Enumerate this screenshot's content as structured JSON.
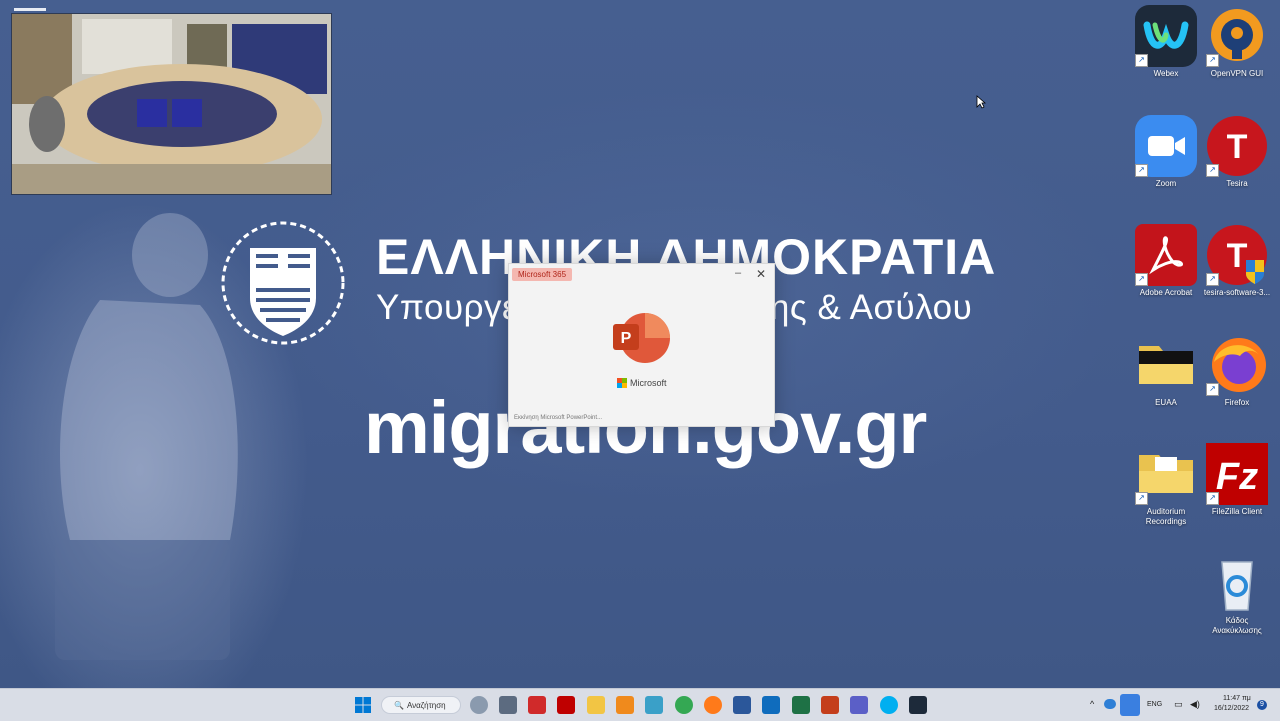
{
  "brand": {
    "title": "ΕΛΛΗΝΙΚΗ ΔΗΜΟΚΡΑΤΙΑ",
    "subtitle": "Υπουργείο Μετανάστευσης & Ασύλου",
    "url": "migration.gov.gr"
  },
  "splash": {
    "badge": "Microsoft 365",
    "company": "Microsoft",
    "status": "Εκκίνηση Microsoft PowerPoint..."
  },
  "desktop_icons": [
    {
      "name": "Webex",
      "icon": "webex-icon"
    },
    {
      "name": "OpenVPN GUI",
      "icon": "openvpn-icon"
    },
    {
      "name": "Zoom",
      "icon": "zoom-icon"
    },
    {
      "name": "Tesira",
      "icon": "tesira-icon"
    },
    {
      "name": "Adobe Acrobat",
      "icon": "acrobat-icon"
    },
    {
      "name": "tesira-software-3...",
      "icon": "tesira-software-icon"
    },
    {
      "name": "EUAA",
      "icon": "folder-icon"
    },
    {
      "name": "Firefox",
      "icon": "firefox-icon"
    },
    {
      "name": "Auditorium Recordings",
      "icon": "folder-icon"
    },
    {
      "name": "FileZilla Client",
      "icon": "filezilla-icon"
    },
    {
      "name": "Κάδος Ανακύκλωσης",
      "icon": "recycle-bin-icon"
    }
  ],
  "taskbar": {
    "search_label": "Αναζήτηση",
    "language": "ENG",
    "time": "11:47 πμ",
    "date": "16/12/2022",
    "notifications": "9"
  },
  "colors": {
    "background": "#435b8c",
    "taskbar": "#d9dde6",
    "accent": "#0078d4"
  }
}
